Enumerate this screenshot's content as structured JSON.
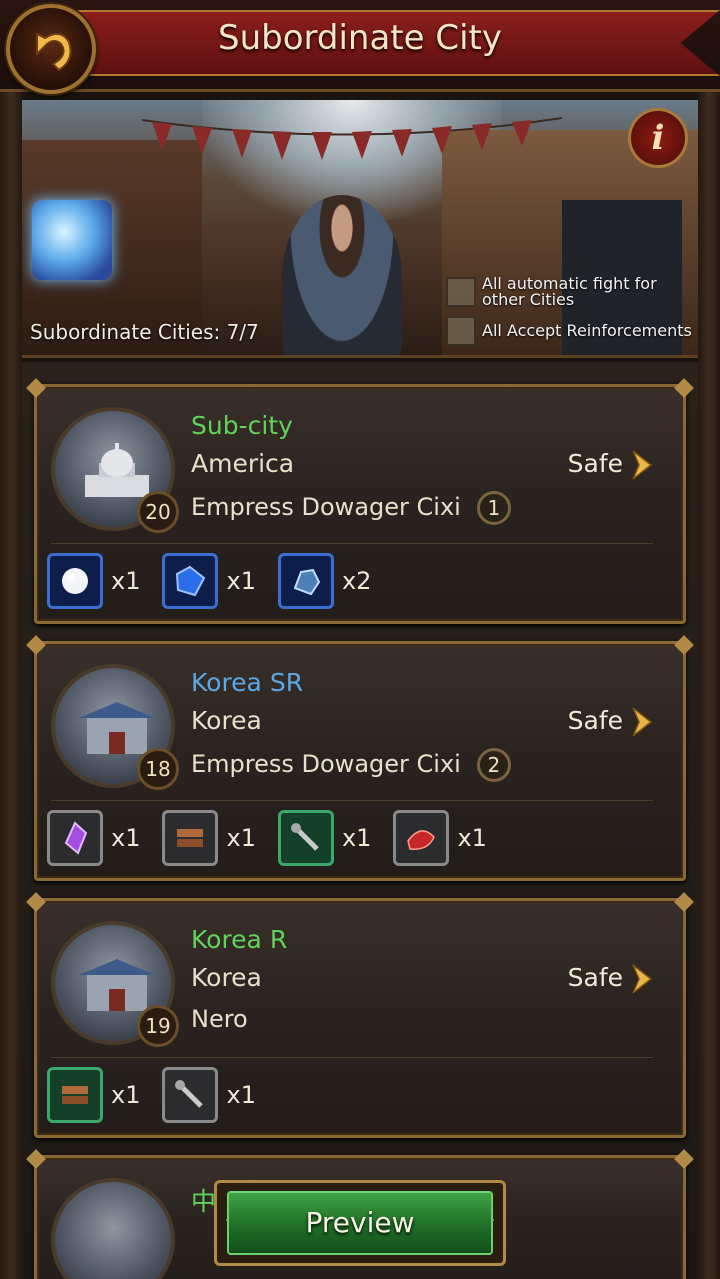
{
  "header": {
    "title": "Subordinate City"
  },
  "banner": {
    "subordinate_cities": "Subordinate Cities: 7/7",
    "options": [
      {
        "label": "All automatic fight for other Cities",
        "checked": false
      },
      {
        "label": "All Accept Reinforcements",
        "checked": false
      }
    ]
  },
  "cities": [
    {
      "title": "Sub-city",
      "title_color": "green",
      "region": "America",
      "owner": "Empress Dowager Cixi",
      "level": "20",
      "rank": "1",
      "status": "Safe",
      "rewards": [
        {
          "icon": "pearl-icon",
          "frame": "blue",
          "qty": "x1"
        },
        {
          "icon": "sapphire-icon",
          "frame": "blue",
          "qty": "x1"
        },
        {
          "icon": "ore-icon",
          "frame": "blue",
          "qty": "x2"
        }
      ]
    },
    {
      "title": "Korea SR",
      "title_color": "blue",
      "region": "Korea",
      "owner": "Empress Dowager Cixi",
      "level": "18",
      "rank": "2",
      "status": "Safe",
      "rewards": [
        {
          "icon": "amethyst-icon",
          "frame": "purple",
          "qty": "x1"
        },
        {
          "icon": "wood-icon",
          "frame": "gray",
          "qty": "x1"
        },
        {
          "icon": "wrench-icon",
          "frame": "green",
          "qty": "x1"
        },
        {
          "icon": "leather-icon",
          "frame": "gray",
          "qty": "x1"
        }
      ]
    },
    {
      "title": "Korea R",
      "title_color": "green",
      "region": "Korea",
      "owner": "Nero",
      "level": "19",
      "rank": "",
      "status": "Safe",
      "rewards": [
        {
          "icon": "wood-icon",
          "frame": "green",
          "qty": "x1"
        },
        {
          "icon": "wrench-icon",
          "frame": "gray",
          "qty": "x1"
        }
      ]
    }
  ],
  "partial_card": {
    "title": "中"
  },
  "preview_button": {
    "label": "Preview"
  }
}
